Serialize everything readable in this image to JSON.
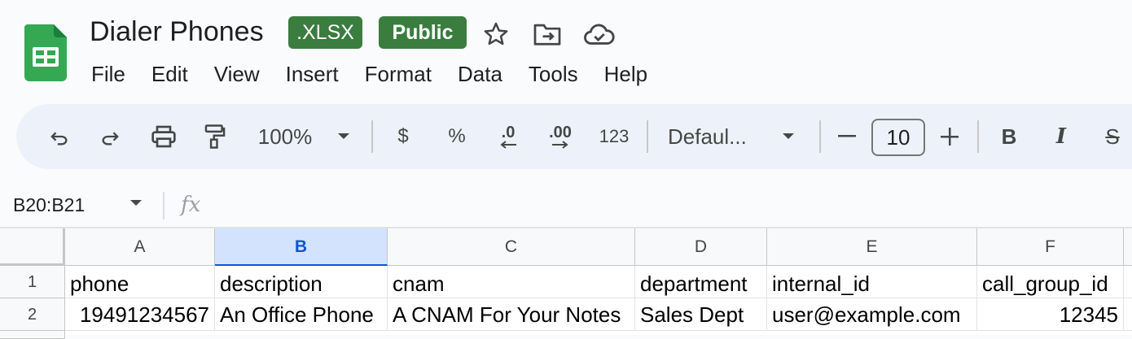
{
  "app": {
    "logo_icon": "sheets-logo-icon"
  },
  "title": {
    "doc_name": "Dialer Phones",
    "format_badge": ".XLSX",
    "visibility_badge": "Public",
    "badge_color": "#3a7d3f",
    "icons": [
      "star-icon",
      "move-to-folder-icon",
      "cloud-saved-icon"
    ]
  },
  "menu": [
    "File",
    "Edit",
    "View",
    "Insert",
    "Format",
    "Data",
    "Tools",
    "Help"
  ],
  "toolbar": {
    "zoom": "100%",
    "currency_label": "$",
    "percent_label": "%",
    "decrease_decimal_label": ".0",
    "increase_decimal_label": ".00",
    "more_formats_label": "123",
    "font": "Defaul...",
    "font_size": "10",
    "bold_label": "B",
    "italic_label": "I",
    "strike_label": "S"
  },
  "formula_bar": {
    "name_box": "B20:B21",
    "fx_label": "fx",
    "formula": ""
  },
  "grid": {
    "columns": [
      "A",
      "B",
      "C",
      "D",
      "E",
      "F"
    ],
    "selected_column": "B",
    "rows": [
      {
        "num": "1",
        "cells": [
          "phone",
          "description",
          "cnam",
          "department",
          "internal_id",
          "call_group_id"
        ]
      },
      {
        "num": "2",
        "cells": [
          "19491234567",
          "An Office Phone",
          "A CNAM For Your Notes",
          "Sales Dept",
          "user@example.com",
          "12345"
        ]
      }
    ]
  }
}
